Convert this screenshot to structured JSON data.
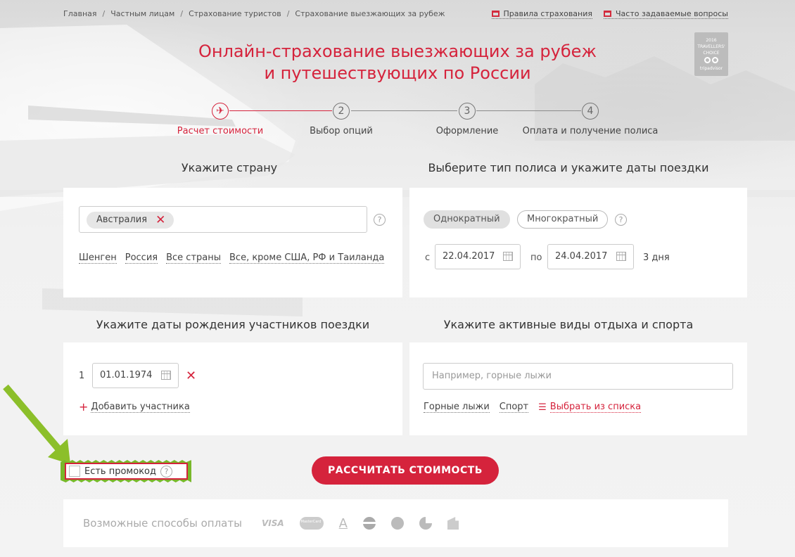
{
  "breadcrumb": [
    "Главная",
    "Частным лицам",
    "Страхование туристов",
    "Страхование выезжающих за рубеж"
  ],
  "breadcrumb_separator": "/",
  "top_links": {
    "rules": "Правила страхования",
    "faq": "Часто задаваемые вопросы"
  },
  "title": {
    "line1": "Онлайн-страхование выезжающих за рубеж",
    "line2": "и путешествующих по России"
  },
  "badge": {
    "year": "2016",
    "line1": "TRAVELLERS'",
    "line2": "CHOICE",
    "brand": "tripadvisor"
  },
  "steps": [
    {
      "icon": "✈",
      "label": "Расчет стоимости",
      "active": true
    },
    {
      "icon": "2",
      "label": "Выбор опций",
      "active": false
    },
    {
      "icon": "3",
      "label": "Оформление",
      "active": false
    },
    {
      "icon": "4",
      "label": "Оплата и получение полиса",
      "active": false
    }
  ],
  "country_section": {
    "heading": "Укажите страну",
    "selected_chip": "Австралия",
    "chip_remove": "✕",
    "help": "?",
    "quick_links": [
      "Шенген",
      "Россия",
      "Все страны",
      "Все, кроме США, РФ и Таиланда"
    ]
  },
  "policy_section": {
    "heading": "Выберите тип полиса и укажите даты поездки",
    "type_single": "Однократный",
    "type_multi": "Многократный",
    "help": "?",
    "from_label": "с",
    "from_date": "22.04.2017",
    "to_label": "по",
    "to_date": "24.04.2017",
    "duration": "3 дня"
  },
  "birth_section": {
    "heading": "Укажите даты рождения участников поездки",
    "participant_index": "1",
    "participant_date": "01.01.1974",
    "remove": "✕",
    "add_label": "Добавить участника",
    "add_icon": "+"
  },
  "activity_section": {
    "heading": "Укажите активные виды отдыха и спорта",
    "placeholder": "Например, горные лыжи",
    "quick_links": [
      "Горные лыжи",
      "Спорт"
    ],
    "choose_list": "Выбрать из списка"
  },
  "promo": {
    "label": "Есть промокод",
    "help": "?"
  },
  "calculate_button": "РАССЧИТАТЬ СТОИМОСТЬ",
  "payments": {
    "label": "Возможные способы оплаты",
    "methods": [
      "VISA",
      "MasterCard",
      "А",
      "",
      "",
      ""
    ]
  },
  "colors": {
    "accent": "#d5233c",
    "highlight": "#78b82a"
  }
}
